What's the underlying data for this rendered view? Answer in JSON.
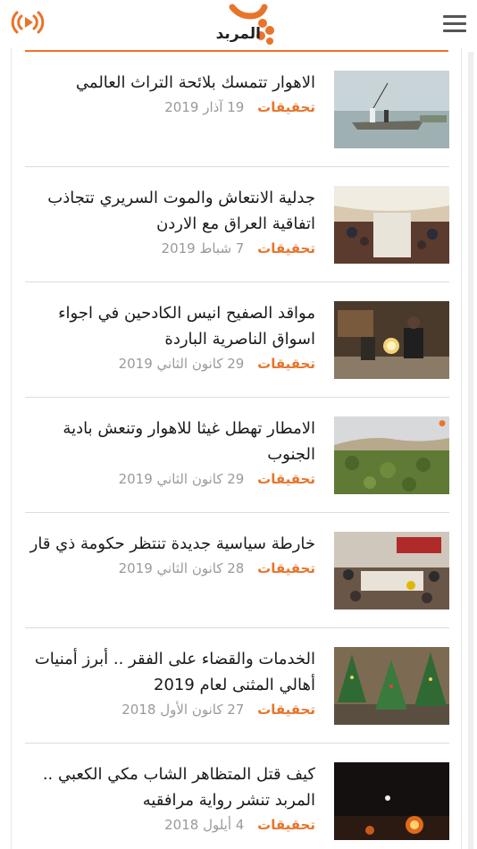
{
  "header": {
    "logo_text": "المربد",
    "radio_icon": "radio-broadcast-icon",
    "menu_icon": "hamburger-menu-icon",
    "brand_color": "#e8742a"
  },
  "articles": [
    {
      "title": "الاهوار تتمسك بلائحة التراث العالمي",
      "category": "تحقيقات",
      "date": "19 آذار 2019",
      "image": "marsh-boat-photo"
    },
    {
      "title": "جدلية الانتعاش والموت السريري تتجاذب اتفاقية العراق مع الاردن",
      "category": "تحقيقات",
      "date": "7 شباط 2019",
      "image": "conference-dinner-photo"
    },
    {
      "title": "مواقد الصفيح انيس الكادحين في اجواء اسواق الناصرية الباردة",
      "category": "تحقيقات",
      "date": "29 كانون الثاني 2019",
      "image": "market-fire-photo"
    },
    {
      "title": "الامطار تهطل غيثا للاهوار وتنعش بادية الجنوب",
      "category": "تحقيقات",
      "date": "29 كانون الثاني 2019",
      "image": "desert-green-photo"
    },
    {
      "title": "خارطة سياسية جديدة تنتظر حكومة ذي قار",
      "category": "تحقيقات",
      "date": "28 كانون الثاني 2019",
      "image": "meeting-hall-photo"
    },
    {
      "title": "الخدمات والقضاء على الفقر .. أبرز أمنيات أهالي المثنى لعام 2019",
      "category": "تحقيقات",
      "date": "27 كانون الأول 2018",
      "image": "christmas-trees-photo"
    },
    {
      "title": "كيف قتل المتظاهر الشاب مكي الكعبي .. المربد تنشر رواية مرافقيه",
      "category": "تحقيقات",
      "date": "4 أيلول 2018",
      "image": "night-protest-fire-photo"
    }
  ]
}
